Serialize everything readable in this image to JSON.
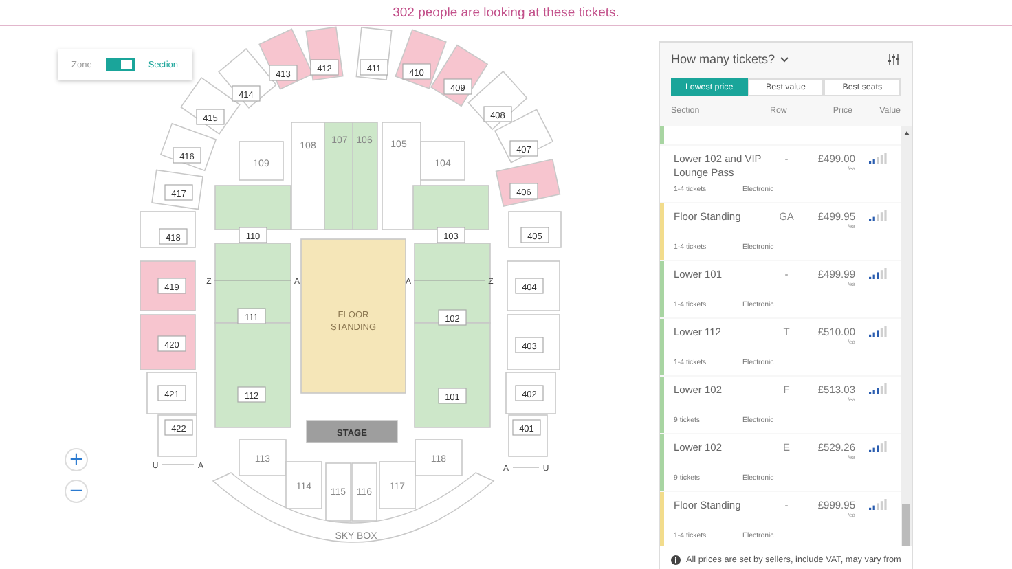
{
  "banner": "302 people are looking at these tickets.",
  "view_toggle": {
    "left_label": "Zone",
    "right_label": "Section",
    "on": true
  },
  "zoom_controls": [
    "+",
    "−"
  ],
  "map": {
    "sections": [
      {
        "label": "413",
        "kind": "seating",
        "color": "#f7c5cf"
      },
      {
        "label": "412",
        "kind": "seating",
        "color": "#f7c5cf"
      },
      {
        "label": "411",
        "kind": "seating",
        "color": "#ffffff"
      },
      {
        "label": "410",
        "kind": "seating",
        "color": "#f7c5cf"
      },
      {
        "label": "409",
        "kind": "seating",
        "color": "#f7c5cf"
      },
      {
        "label": "414",
        "kind": "seating",
        "color": "#ffffff"
      },
      {
        "label": "408",
        "kind": "seating",
        "color": "#ffffff"
      },
      {
        "label": "415",
        "kind": "seating",
        "color": "#ffffff"
      },
      {
        "label": "407",
        "kind": "seating",
        "color": "#ffffff"
      },
      {
        "label": "416",
        "kind": "seating",
        "color": "#ffffff"
      },
      {
        "label": "406",
        "kind": "seating",
        "color": "#f7c5cf"
      },
      {
        "label": "417",
        "kind": "seating",
        "color": "#ffffff"
      },
      {
        "label": "108",
        "kind": "seating",
        "color": "#ffffff"
      },
      {
        "label": "107",
        "kind": "seating",
        "color": "#cde7c9"
      },
      {
        "label": "106",
        "kind": "seating",
        "color": "#cde7c9"
      },
      {
        "label": "105",
        "kind": "seating",
        "color": "#ffffff"
      },
      {
        "label": "109",
        "kind": "seating",
        "color": "#ffffff"
      },
      {
        "label": "104",
        "kind": "seating",
        "color": "#ffffff"
      },
      {
        "label": "418",
        "kind": "seating",
        "color": "#ffffff"
      },
      {
        "label": "110",
        "kind": "seating",
        "color": "#cde7c9"
      },
      {
        "label": "103",
        "kind": "seating",
        "color": "#cde7c9"
      },
      {
        "label": "405",
        "kind": "seating",
        "color": "#ffffff"
      },
      {
        "label": "419",
        "kind": "seating",
        "color": "#f7c5cf"
      },
      {
        "label": "404",
        "kind": "seating",
        "color": "#ffffff"
      },
      {
        "label": "111",
        "kind": "seating",
        "color": "#cde7c9"
      },
      {
        "label": "FLOOR STANDING",
        "kind": "floor",
        "color": "#f5e6b8"
      },
      {
        "label": "102",
        "kind": "seating",
        "color": "#cde7c9"
      },
      {
        "label": "420",
        "kind": "seating",
        "color": "#f7c5cf"
      },
      {
        "label": "403",
        "kind": "seating",
        "color": "#ffffff"
      },
      {
        "label": "421",
        "kind": "seating",
        "color": "#ffffff"
      },
      {
        "label": "112",
        "kind": "seating",
        "color": "#cde7c9"
      },
      {
        "label": "101",
        "kind": "seating",
        "color": "#cde7c9"
      },
      {
        "label": "402",
        "kind": "seating",
        "color": "#ffffff"
      },
      {
        "label": "422",
        "kind": "seating",
        "color": "#ffffff"
      },
      {
        "label": "STAGE",
        "kind": "stage",
        "color": "#9e9e9e"
      },
      {
        "label": "401",
        "kind": "seating",
        "color": "#ffffff"
      },
      {
        "label": "113",
        "kind": "seating",
        "color": "#ffffff"
      },
      {
        "label": "118",
        "kind": "seating",
        "color": "#ffffff"
      },
      {
        "label": "114",
        "kind": "seating",
        "color": "#ffffff"
      },
      {
        "label": "115",
        "kind": "seating",
        "color": "#ffffff"
      },
      {
        "label": "116",
        "kind": "seating",
        "color": "#ffffff"
      },
      {
        "label": "117",
        "kind": "seating",
        "color": "#ffffff"
      },
      {
        "label": "SKY BOX",
        "kind": "skybox",
        "color": "#ffffff"
      }
    ],
    "row_markers": [
      "Z",
      "A",
      "A",
      "Z",
      "U",
      "A",
      "A",
      "U"
    ]
  },
  "panel": {
    "title": "How many tickets?",
    "tabs": [
      {
        "label": "Lowest price",
        "selected": true
      },
      {
        "label": "Best value",
        "selected": false
      },
      {
        "label": "Best seats",
        "selected": false
      }
    ],
    "columns": [
      "Section",
      "Row",
      "Price",
      "Value"
    ],
    "listings": [
      {
        "kind": "partial",
        "color": "#a8d5a2"
      },
      {
        "kind": "listing",
        "section": "Lower 102 and VIP Lounge Pass",
        "row": "-",
        "price": "£499.00",
        "unit": "/ea",
        "quantity": "1-4 tickets",
        "delivery": "Electronic",
        "level": 0.4
      },
      {
        "kind": "listing",
        "color": "#f2dc8c",
        "section": "Floor Standing",
        "row": "GA",
        "price": "£499.95",
        "unit": "/ea",
        "quantity": "1-4 tickets",
        "delivery": "Electronic",
        "level": 0.4
      },
      {
        "kind": "listing",
        "color": "#a8d5a2",
        "section": "Lower 101",
        "row": "-",
        "price": "£499.99",
        "unit": "/ea",
        "quantity": "1-4 tickets",
        "delivery": "Electronic",
        "level": 0.6
      },
      {
        "kind": "listing",
        "color": "#a8d5a2",
        "section": "Lower 112",
        "row": "T",
        "price": "£510.00",
        "unit": "/ea",
        "quantity": "1-4 tickets",
        "delivery": "Electronic",
        "level": 0.6
      },
      {
        "kind": "listing",
        "color": "#a8d5a2",
        "section": "Lower 102",
        "row": "F",
        "price": "£513.03",
        "unit": "/ea",
        "quantity": "9 tickets",
        "delivery": "Electronic",
        "level": 0.6
      },
      {
        "kind": "listing",
        "color": "#a8d5a2",
        "section": "Lower 102",
        "row": "E",
        "price": "£529.26",
        "unit": "/ea",
        "quantity": "9 tickets",
        "delivery": "Electronic",
        "level": 0.6
      },
      {
        "kind": "listing",
        "color": "#f2dc8c",
        "section": "Floor Standing",
        "row": "-",
        "price": "£999.95",
        "unit": "/ea",
        "quantity": "1-4 tickets",
        "delivery": "Electronic",
        "level": 0.4
      }
    ],
    "footnote": "All prices are set by sellers, include VAT, may vary from"
  }
}
